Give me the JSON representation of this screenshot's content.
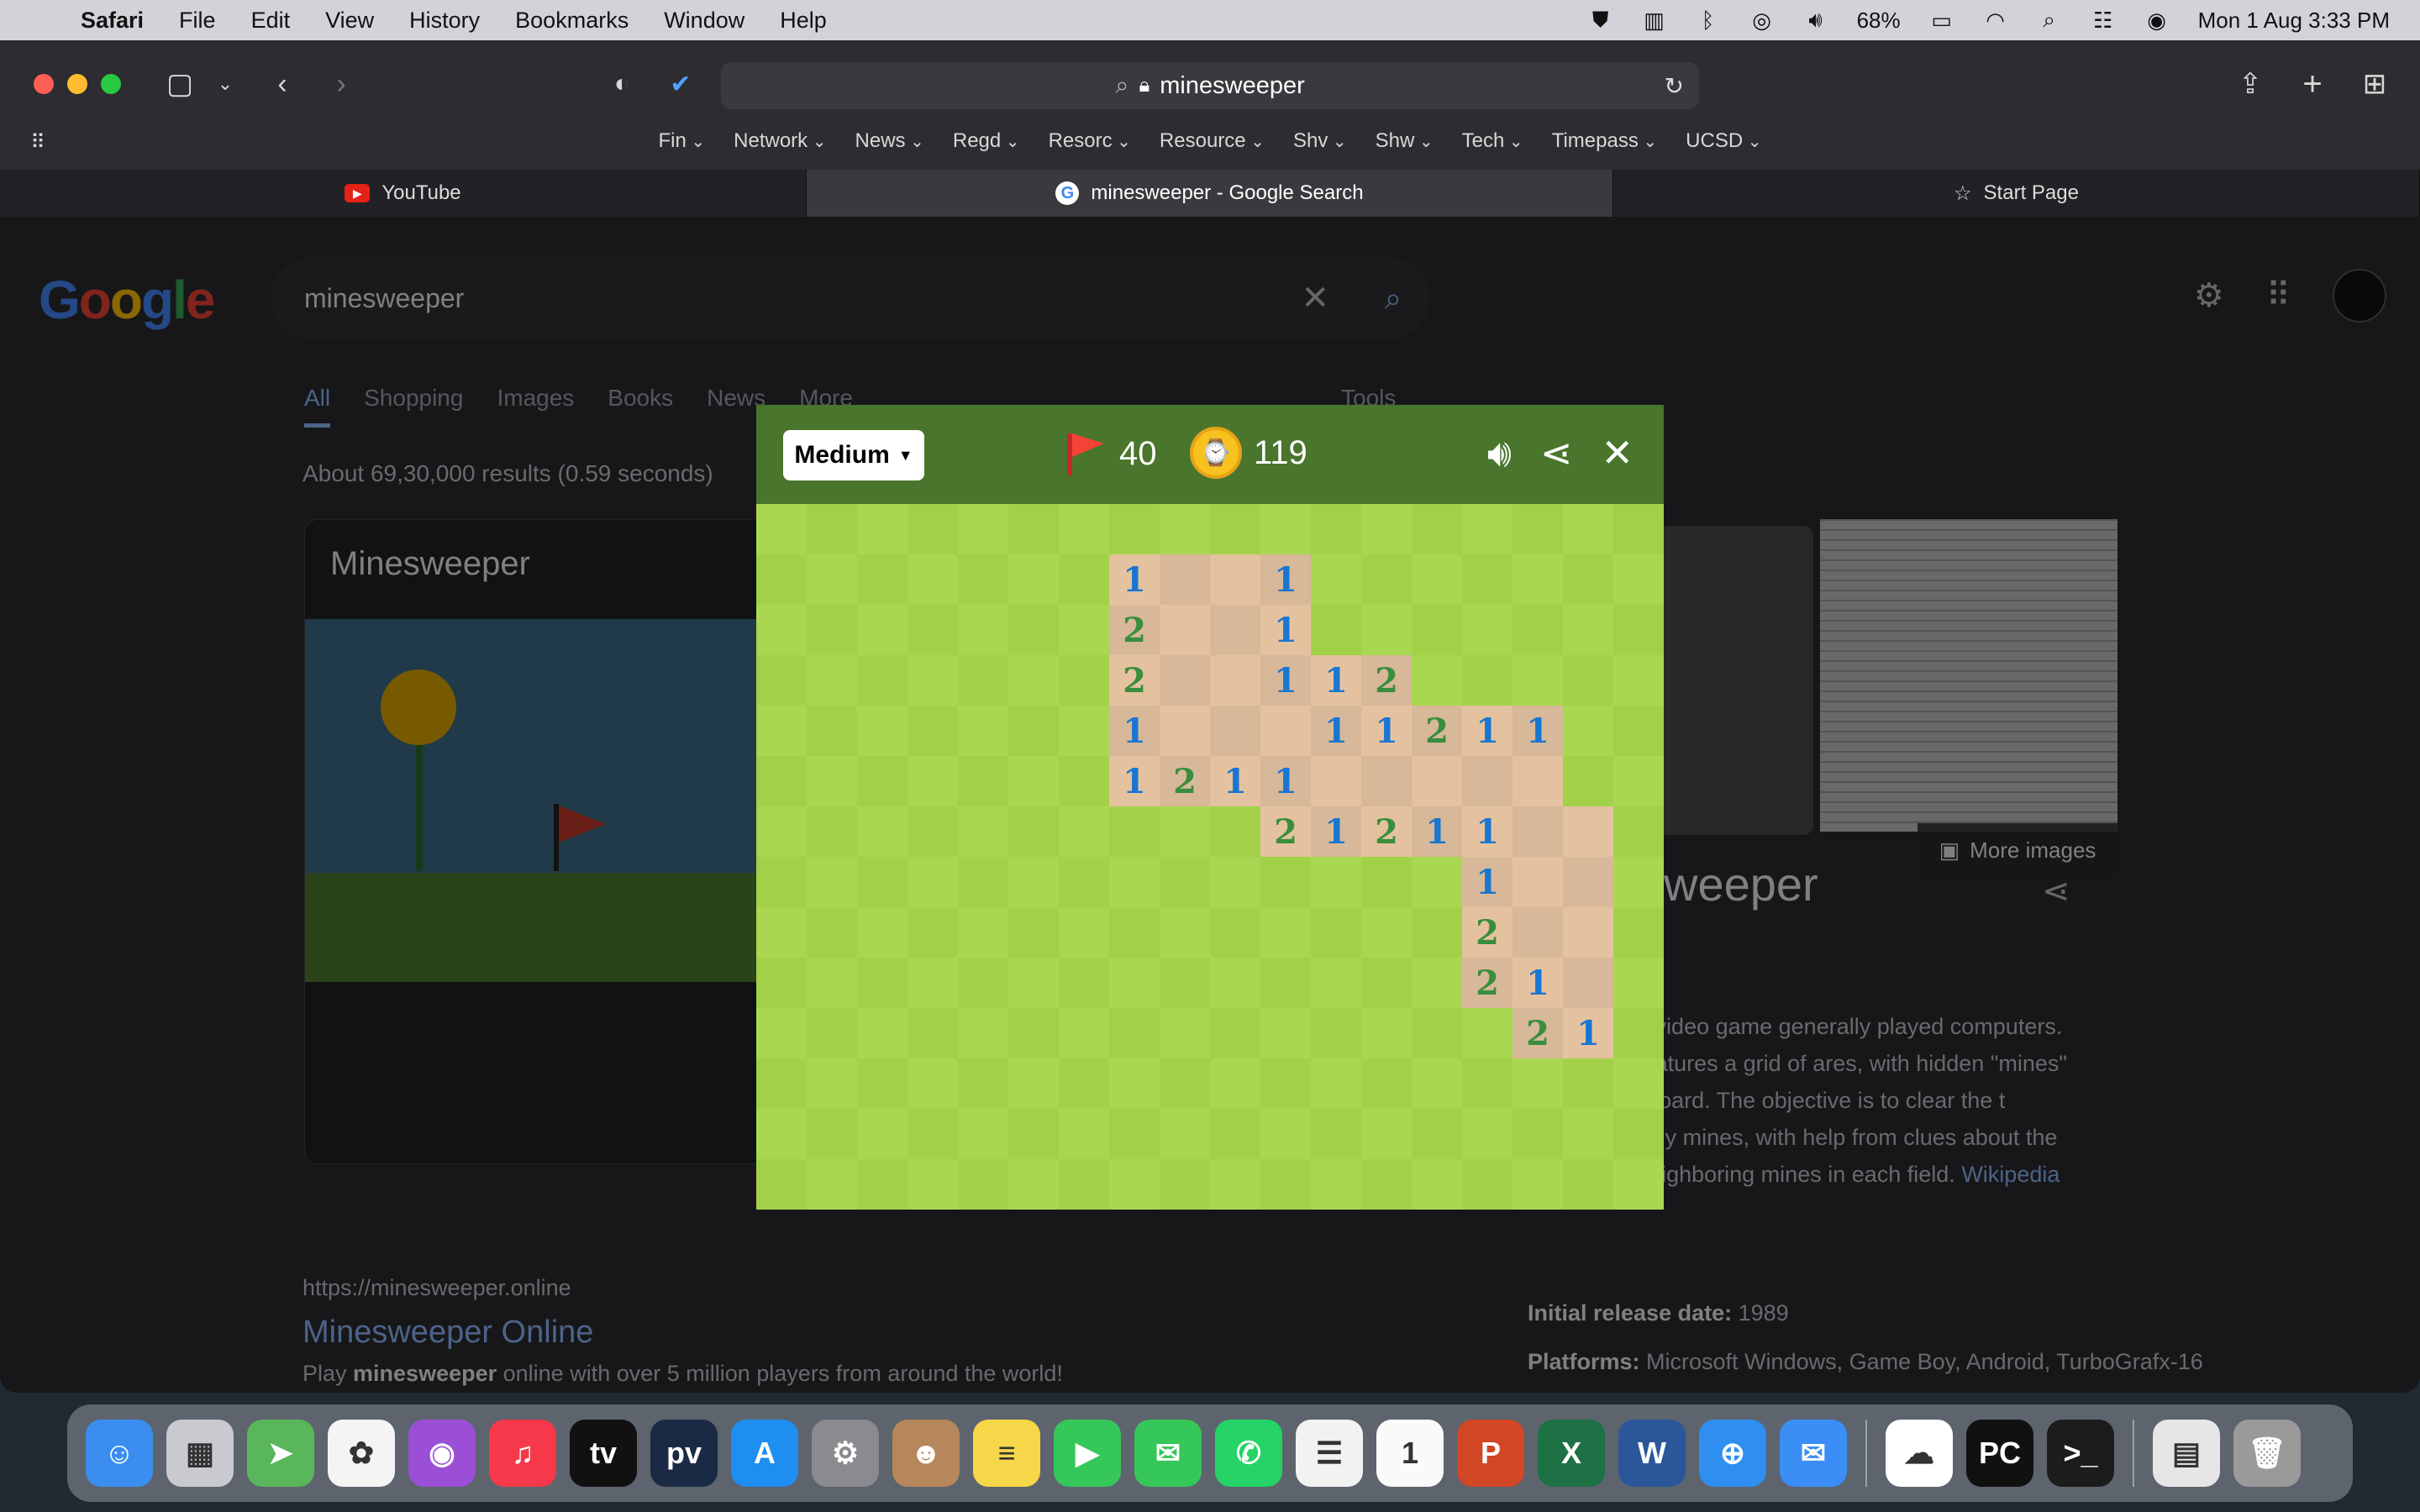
{
  "menubar": {
    "app": "Safari",
    "items": [
      "File",
      "Edit",
      "View",
      "History",
      "Bookmarks",
      "Window",
      "Help"
    ],
    "battery": "68%",
    "datetime": "Mon 1 Aug  3:33 PM"
  },
  "browser": {
    "url": "minesweeper",
    "favorites": [
      "Fin",
      "Network",
      "News",
      "Regd",
      "Resorc",
      "Resource",
      "Shv",
      "Shw",
      "Tech",
      "Timepass",
      "UCSD"
    ],
    "tabs": [
      {
        "label": "YouTube",
        "icon": "youtube-icon"
      },
      {
        "label": "minesweeper - Google Search",
        "icon": "google-icon"
      },
      {
        "label": "Start Page",
        "icon": "star-icon"
      }
    ]
  },
  "google": {
    "logo": "Google",
    "query": "minesweeper",
    "nav": [
      "All",
      "Shopping",
      "Images",
      "Books",
      "News",
      "More"
    ],
    "tools": "Tools",
    "stats": "About 69,30,000 results (0.59 seconds)",
    "card_title": "Minesweeper",
    "more_images": "More images",
    "kp_title": "weeper",
    "kp_desc": "r is a puzzle video game generally played computers. The game features a grid of ares, with hidden \"mines\" scattered e board. The objective is to clear the t detonating any mines, with help from clues about the number of neighboring mines in each field.",
    "kp_link": "Wikipedia",
    "release_label": "Initial release date:",
    "release_value": "1989",
    "platforms_label": "Platforms:",
    "platforms_value": "Microsoft Windows, Game Boy, Android, TurboGrafx-16",
    "result_url": "https://minesweeper.online",
    "result_title": "Minesweeper Online",
    "result_desc_pre": "Play ",
    "result_desc_bold": "minesweeper",
    "result_desc_post": " online with over 5 million players from around the world!"
  },
  "game": {
    "difficulty": "Medium",
    "flags": "40",
    "time": "119",
    "colors": {
      "n1": "#1976d2",
      "n2": "#388e3c",
      "grassLight": "#aad751",
      "grassDark": "#a2d149",
      "dirtLight": "#e5c29f",
      "dirtDark": "#d7b899"
    },
    "rows": [
      "-----------------",
      "-------1..1------",
      "-------2..1------",
      "-------2..112----",
      "-------1...11211",
      "-------1211.....",
      "----------21211..",
      "--------------1..",
      "--------------2..",
      "--------------21.",
      "---------------21",
      "-----------------",
      "-----------------",
      "-----------------"
    ]
  },
  "dock": {
    "apps": [
      {
        "name": "finder-icon",
        "color": "#3b8ef0",
        "glyph": "☺"
      },
      {
        "name": "launchpad-icon",
        "color": "#c9c9d0",
        "glyph": "▦"
      },
      {
        "name": "maps-icon",
        "color": "#5ab65a",
        "glyph": "➤"
      },
      {
        "name": "photos-icon",
        "color": "#f4f4f4",
        "glyph": "✿"
      },
      {
        "name": "podcasts-icon",
        "color": "#9b4fd6",
        "glyph": "◉"
      },
      {
        "name": "music-icon",
        "color": "#f5384a",
        "glyph": "♫"
      },
      {
        "name": "tv-icon",
        "color": "#111111",
        "glyph": "tv"
      },
      {
        "name": "prime-video-icon",
        "color": "#1a2a44",
        "glyph": "pv"
      },
      {
        "name": "app-store-icon",
        "color": "#1e8ef0",
        "glyph": "A"
      },
      {
        "name": "system-settings-icon",
        "color": "#8a8a8f",
        "glyph": "⚙"
      },
      {
        "name": "contacts-icon",
        "color": "#b5875a",
        "glyph": "☻"
      },
      {
        "name": "notes-icon",
        "color": "#f6d74a",
        "glyph": "≡"
      },
      {
        "name": "facetime-icon",
        "color": "#35c759",
        "glyph": "▶"
      },
      {
        "name": "messages-icon",
        "color": "#35c759",
        "glyph": "✉"
      },
      {
        "name": "whatsapp-icon",
        "color": "#25d366",
        "glyph": "✆"
      },
      {
        "name": "reminders-icon",
        "color": "#f2f2f2",
        "glyph": "☰"
      },
      {
        "name": "calendar-icon",
        "color": "#fafafa",
        "glyph": "1"
      },
      {
        "name": "powerpoint-icon",
        "color": "#d24726",
        "glyph": "P"
      },
      {
        "name": "excel-icon",
        "color": "#1e7145",
        "glyph": "X"
      },
      {
        "name": "word-icon",
        "color": "#2b579a",
        "glyph": "W"
      },
      {
        "name": "safari-icon",
        "color": "#2e8ff0",
        "glyph": "⊕"
      },
      {
        "name": "mail-icon",
        "color": "#3a8ef6",
        "glyph": "✉"
      },
      {
        "name": "onedrive-icon",
        "color": "#ffffff",
        "glyph": "☁"
      },
      {
        "name": "pycharm-icon",
        "color": "#111111",
        "glyph": "PC"
      },
      {
        "name": "terminal-icon",
        "color": "#1c1c1c",
        "glyph": ">_"
      },
      {
        "name": "document-icon",
        "color": "#e6e6e6",
        "glyph": "▤"
      },
      {
        "name": "trash-icon",
        "color": "#9a9a9a",
        "glyph": "🗑"
      }
    ]
  }
}
